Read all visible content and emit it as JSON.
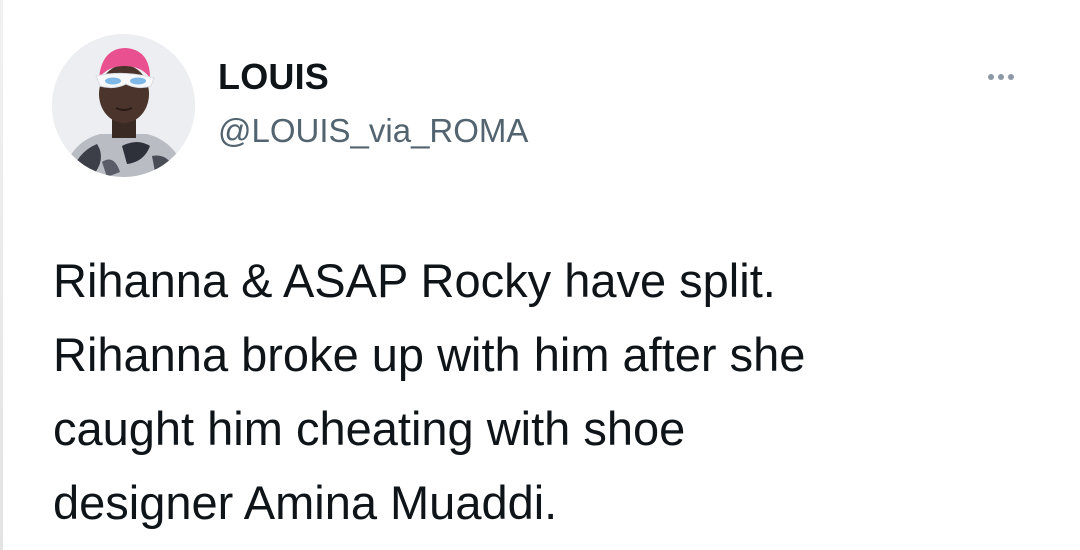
{
  "author": {
    "display_name": "LOUIS",
    "handle": "@LOUIS_via_ROMA",
    "avatar_icon": "profile-photo-icon"
  },
  "actions": {
    "more_icon": "more-horizontal-icon"
  },
  "tweet": {
    "lines": [
      "Rihanna & ASAP Rocky have split.",
      "Rihanna broke up with him after she",
      "caught him cheating with shoe",
      "designer Amina Muaddi."
    ]
  },
  "colors": {
    "text": "#0f1419",
    "secondary_text": "#536471",
    "icon_gray": "#8b98a5",
    "avatar_hair": "#e8508f"
  }
}
